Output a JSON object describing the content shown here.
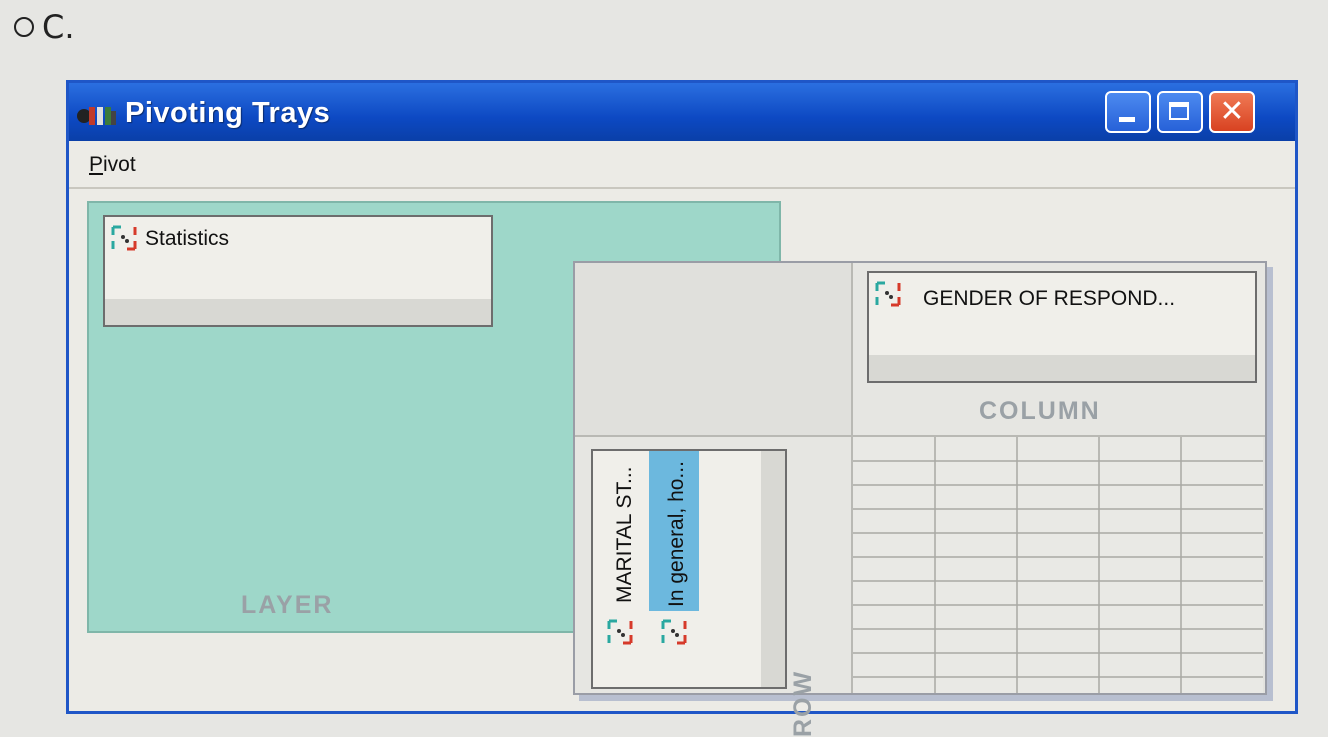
{
  "option": {
    "label": "C."
  },
  "window": {
    "title": "Pivoting Trays",
    "controls": {
      "minimize": "minimize",
      "maximize": "maximize",
      "close": "✕"
    },
    "accent": "#0d49c3"
  },
  "menu": {
    "items": [
      {
        "mnemonic": "P",
        "rest": "ivot"
      }
    ]
  },
  "trays": {
    "layer": {
      "label": "LAYER",
      "color": "#9ed7c9",
      "fields": [
        {
          "label": "Statistics",
          "icon": "pivot-field-icon"
        }
      ]
    },
    "column": {
      "label": "COLUMN",
      "fields": [
        {
          "label": "GENDER OF RESPOND...",
          "icon": "pivot-field-icon"
        }
      ]
    },
    "row": {
      "label": "ROW",
      "fields": [
        {
          "label": "MARITAL ST...",
          "icon": "pivot-field-icon",
          "selected": false
        },
        {
          "label": "In general, ho...",
          "icon": "pivot-field-icon",
          "selected": true
        }
      ]
    }
  }
}
